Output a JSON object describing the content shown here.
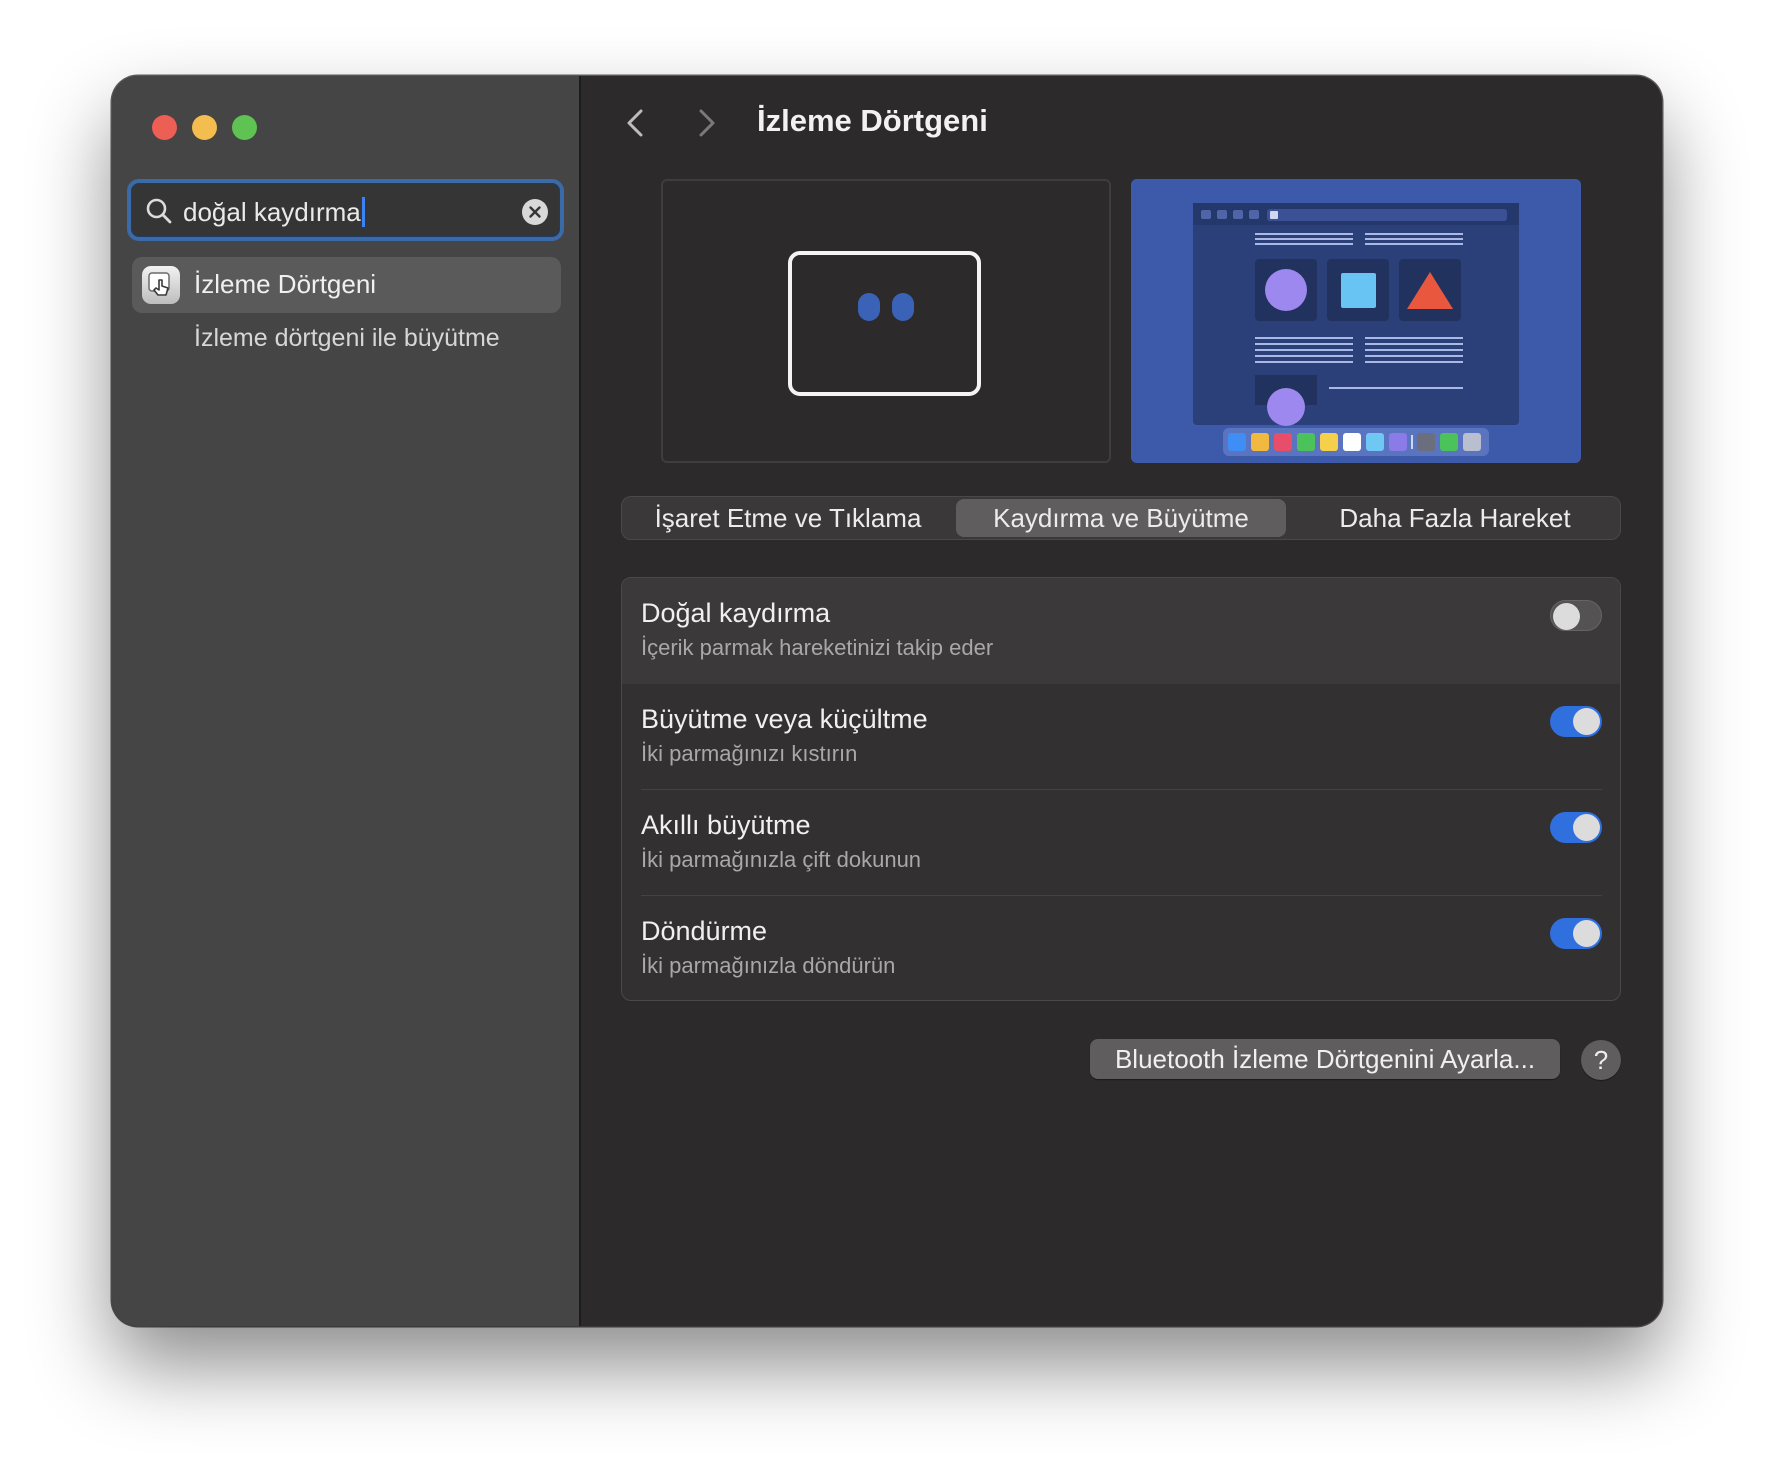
{
  "sidebar": {
    "search": {
      "value": "doğal kaydırma"
    },
    "results": [
      {
        "label": "İzleme Dörtgeni"
      },
      {
        "label": "İzleme dörtgeni ile büyütme"
      }
    ]
  },
  "header": {
    "title": "İzleme Dörtgeni"
  },
  "tabs": [
    {
      "label": "İşaret Etme ve Tıklama",
      "selected": false
    },
    {
      "label": "Kaydırma ve Büyütme",
      "selected": true
    },
    {
      "label": "Daha Fazla Hareket",
      "selected": false
    }
  ],
  "settings": [
    {
      "title": "Doğal kaydırma",
      "subtitle": "İçerik parmak hareketinizi takip eder",
      "enabled": false
    },
    {
      "title": "Büyütme veya küçültme",
      "subtitle": "İki parmağınızı kıstırın",
      "enabled": true
    },
    {
      "title": "Akıllı büyütme",
      "subtitle": "İki parmağınızla çift dokunun",
      "enabled": true
    },
    {
      "title": "Döndürme",
      "subtitle": "İki parmağınızla döndürün",
      "enabled": true
    }
  ],
  "footer": {
    "bluetooth_button": "Bluetooth İzleme Dörtgenini Ayarla...",
    "help": "?"
  },
  "colors": {
    "accent": "#2f6fde",
    "window_bg": "#2c2a2b",
    "sidebar_bg": "#454545"
  }
}
